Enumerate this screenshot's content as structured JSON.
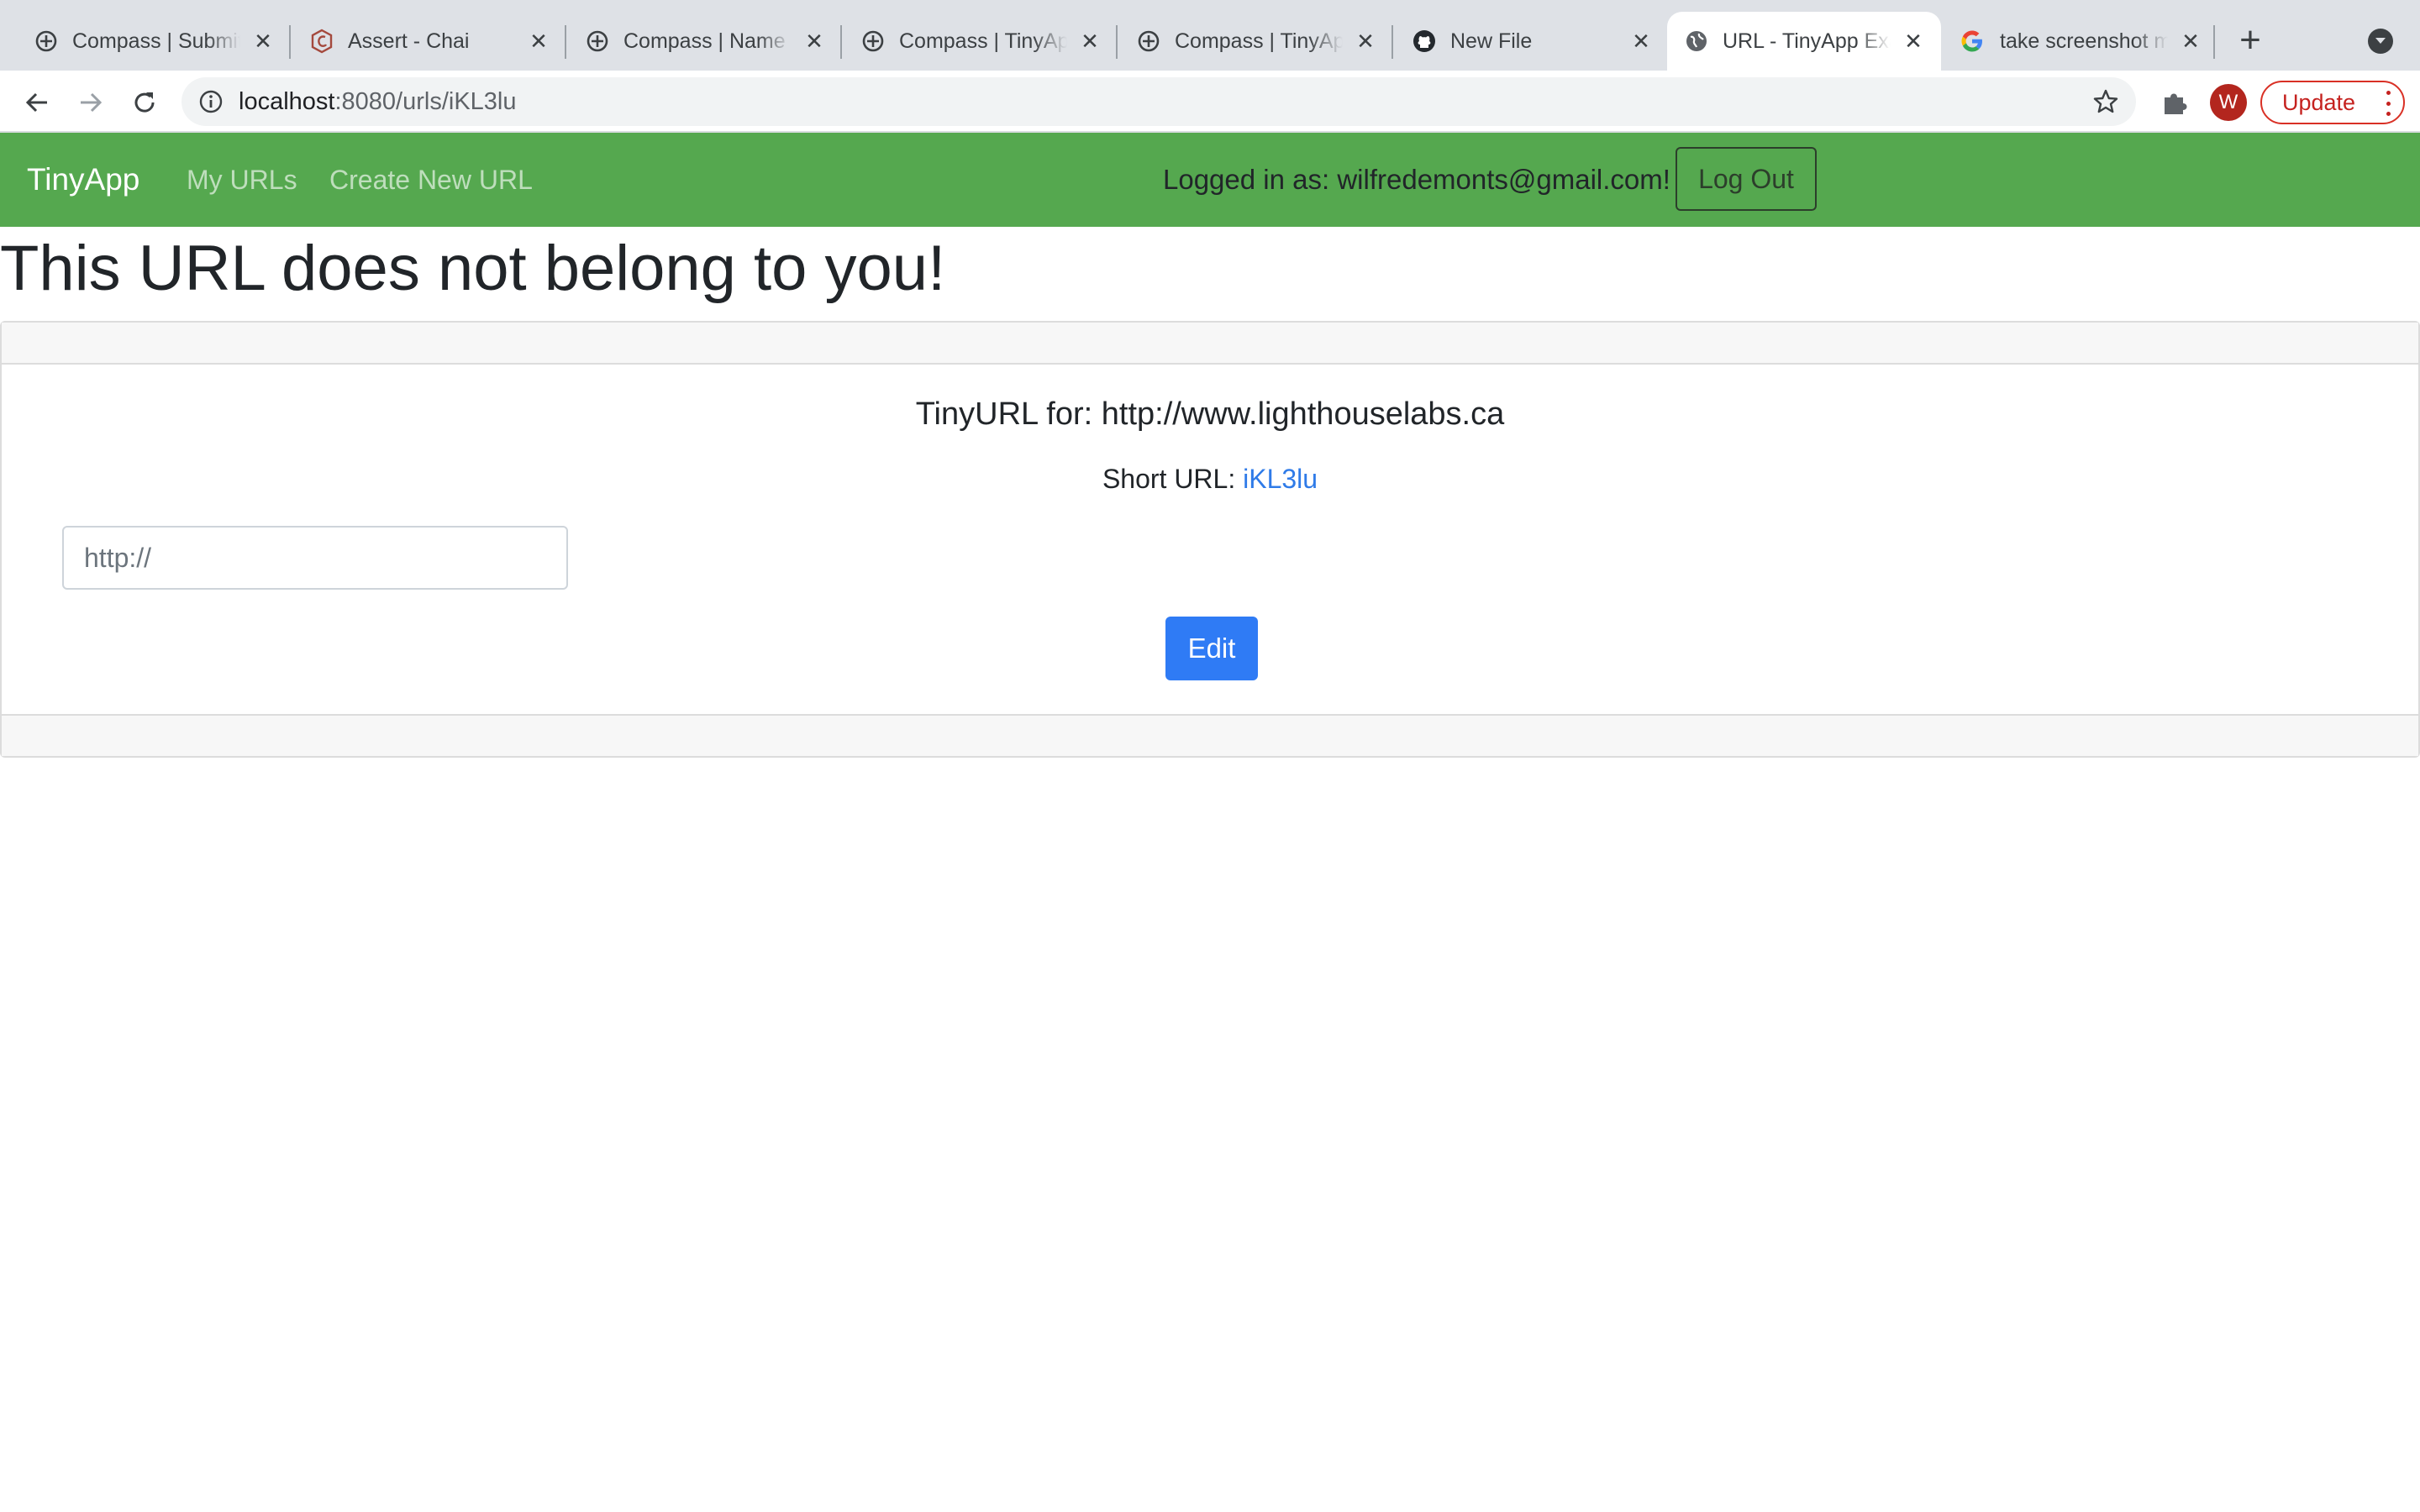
{
  "browser": {
    "tabs": [
      {
        "title": "Compass | Submit",
        "favicon": "compass-icon",
        "active": false
      },
      {
        "title": "Assert - Chai",
        "favicon": "chai-icon",
        "active": false
      },
      {
        "title": "Compass | Name",
        "favicon": "compass-icon",
        "active": false
      },
      {
        "title": "Compass | TinyApp",
        "favicon": "compass-icon",
        "active": false
      },
      {
        "title": "Compass | TinyApp",
        "favicon": "compass-icon",
        "active": false
      },
      {
        "title": "New File",
        "favicon": "github-icon",
        "active": false
      },
      {
        "title": "URL - TinyApp Example",
        "favicon": "globe-icon",
        "active": true
      },
      {
        "title": "take screenshot mac",
        "favicon": "google-icon",
        "active": false
      }
    ],
    "address": {
      "host": "localhost",
      "rest": ":8080/urls/iKL3lu"
    },
    "profile_initial": "W",
    "update_label": "Update",
    "colors": {
      "tabstrip": "#dee1e6",
      "update": "#d93025",
      "profile": "#b3261e"
    }
  },
  "nav": {
    "brand": "TinyApp",
    "links": [
      "My URLs",
      "Create New URL"
    ],
    "logged_in_text": "Logged in as: wilfredemonts@gmail.com!",
    "logout_label": "Log Out",
    "color": "#55a84f"
  },
  "main": {
    "title": "This URL does not belong to you!",
    "card": {
      "heading": "TinyURL for: http://www.lighthouselabs.ca",
      "short_url_label": "Short URL:",
      "short_url_value": "iKL3lu",
      "input_placeholder": "http://",
      "input_value": "",
      "edit_label": "Edit",
      "edit_color": "#2f7bf5"
    }
  }
}
